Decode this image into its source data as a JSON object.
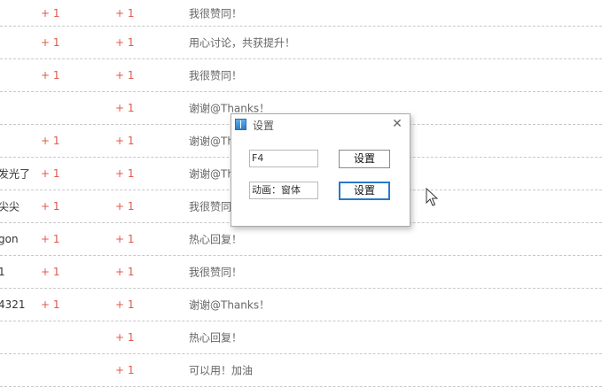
{
  "rating_rows": [
    {
      "user": "",
      "score1": "+ 1",
      "score2": "+ 1",
      "reason": "我很赞同！"
    },
    {
      "user": "",
      "score1": "+ 1",
      "score2": "+ 1",
      "reason": "用心讨论，共获提升！"
    },
    {
      "user": "",
      "score1": "+ 1",
      "score2": "+ 1",
      "reason": "我很赞同！"
    },
    {
      "user": "",
      "score1": "",
      "score2": "+ 1",
      "reason": "谢谢@Thanks！"
    },
    {
      "user": "",
      "score1": "+ 1",
      "score2": "+ 1",
      "reason": "谢谢@Th"
    },
    {
      "user": "发光了",
      "score1": "+ 1",
      "score2": "+ 1",
      "reason": "谢谢@Th"
    },
    {
      "user": "尖尖",
      "score1": "+ 1",
      "score2": "+ 1",
      "reason": "我很赞同"
    },
    {
      "user": "gon",
      "score1": "+ 1",
      "score2": "+ 1",
      "reason": "热心回复！"
    },
    {
      "user": "1",
      "score1": "+ 1",
      "score2": "+ 1",
      "reason": "我很赞同！"
    },
    {
      "user": "4321",
      "score1": "+ 1",
      "score2": "+ 1",
      "reason": "谢谢@Thanks！"
    },
    {
      "user": "",
      "score1": "",
      "score2": "+ 1",
      "reason": "热心回复！"
    },
    {
      "user": "",
      "score1": "",
      "score2": "+ 1",
      "reason": "可以用！加油"
    }
  ],
  "dialog": {
    "title": "设置",
    "close_symbol": "✕",
    "hotkey_value": "F4",
    "animation_value": "动画：窗体",
    "set_button_1": "设置",
    "set_button_2": "设置"
  },
  "colors": {
    "score_red": "#e05a4a",
    "focus_blue": "#2a78c8"
  },
  "icons": {
    "title": "app-icon",
    "close": "close-icon",
    "cursor": "mouse-pointer-icon"
  }
}
